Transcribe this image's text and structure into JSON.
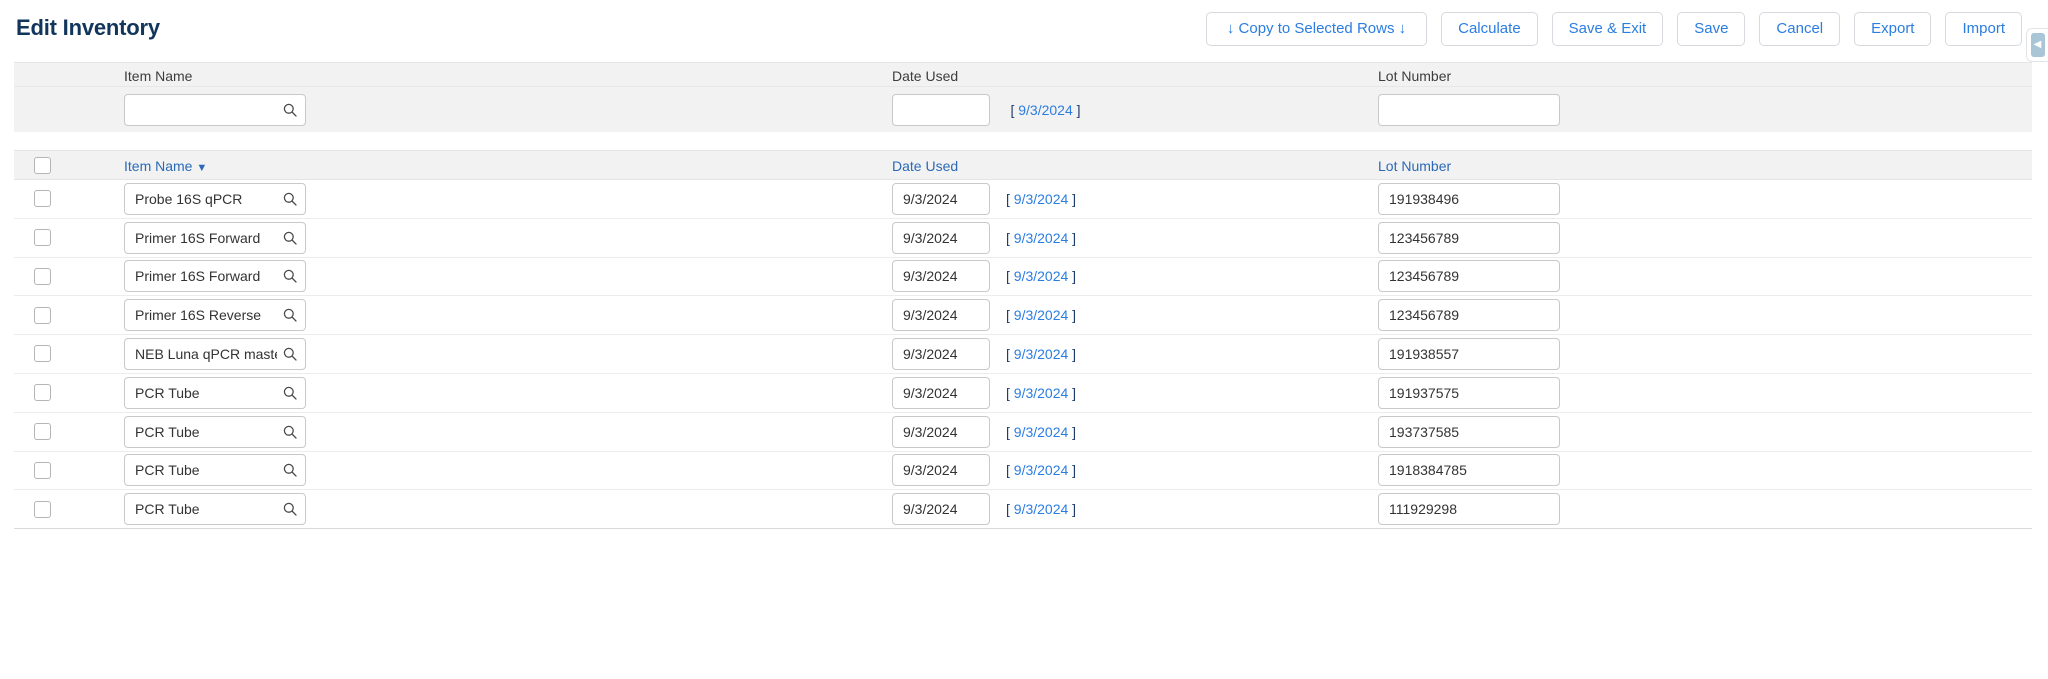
{
  "header": {
    "title": "Edit Inventory",
    "buttons": [
      {
        "label": "↓ Copy to Selected Rows ↓",
        "name": "copy-to-selected-rows-button"
      },
      {
        "label": "Calculate",
        "name": "calculate-button"
      },
      {
        "label": "Save & Exit",
        "name": "save-and-exit-button"
      },
      {
        "label": "Save",
        "name": "save-button"
      },
      {
        "label": "Cancel",
        "name": "cancel-button"
      },
      {
        "label": "Export",
        "name": "export-button"
      },
      {
        "label": "Import",
        "name": "import-button"
      }
    ],
    "edge_tab_icon": "chevron-left-icon"
  },
  "filter_row": {
    "labels": {
      "item_name": "Item Name",
      "date_used": "Date Used",
      "lot_number": "Lot Number"
    },
    "item_name_value": "",
    "item_name_placeholder": "",
    "date_used_value": "",
    "date_used_placeholder": "",
    "date_hint_open": "[",
    "date_hint": "9/3/2024",
    "date_hint_close": "]",
    "lot_number_value": "",
    "lot_number_placeholder": "",
    "search_icon": "search-icon"
  },
  "columns": {
    "select_all": false,
    "item_name": "Item Name",
    "item_name_sort": "▼",
    "date_used": "Date Used",
    "lot_number": "Lot Number"
  },
  "rows": [
    {
      "selected": false,
      "item_name": "Probe 16S qPCR",
      "date_used": "9/3/2024",
      "date_hint": "9/3/2024",
      "lot_number": "191938496"
    },
    {
      "selected": false,
      "item_name": "Primer 16S Forward",
      "date_used": "9/3/2024",
      "date_hint": "9/3/2024",
      "lot_number": "123456789"
    },
    {
      "selected": false,
      "item_name": "Primer 16S Forward",
      "date_used": "9/3/2024",
      "date_hint": "9/3/2024",
      "lot_number": "123456789"
    },
    {
      "selected": false,
      "item_name": "Primer 16S Reverse",
      "date_used": "9/3/2024",
      "date_hint": "9/3/2024",
      "lot_number": "123456789"
    },
    {
      "selected": false,
      "item_name": "NEB Luna qPCR master",
      "date_used": "9/3/2024",
      "date_hint": "9/3/2024",
      "lot_number": "191938557"
    },
    {
      "selected": false,
      "item_name": "PCR Tube",
      "date_used": "9/3/2024",
      "date_hint": "9/3/2024",
      "lot_number": "191937575"
    },
    {
      "selected": false,
      "item_name": "PCR Tube",
      "date_used": "9/3/2024",
      "date_hint": "9/3/2024",
      "lot_number": "193737585"
    },
    {
      "selected": false,
      "item_name": "PCR Tube",
      "date_used": "9/3/2024",
      "date_hint": "9/3/2024",
      "lot_number": "1918384785"
    },
    {
      "selected": false,
      "item_name": "PCR Tube",
      "date_used": "9/3/2024",
      "date_hint": "9/3/2024",
      "lot_number": "111929298"
    }
  ],
  "colors": {
    "title": "#12355b",
    "link": "#2a7de1",
    "header_link": "#2a6ab8",
    "band": "#f2f2f2",
    "border": "#c9c9c9"
  }
}
